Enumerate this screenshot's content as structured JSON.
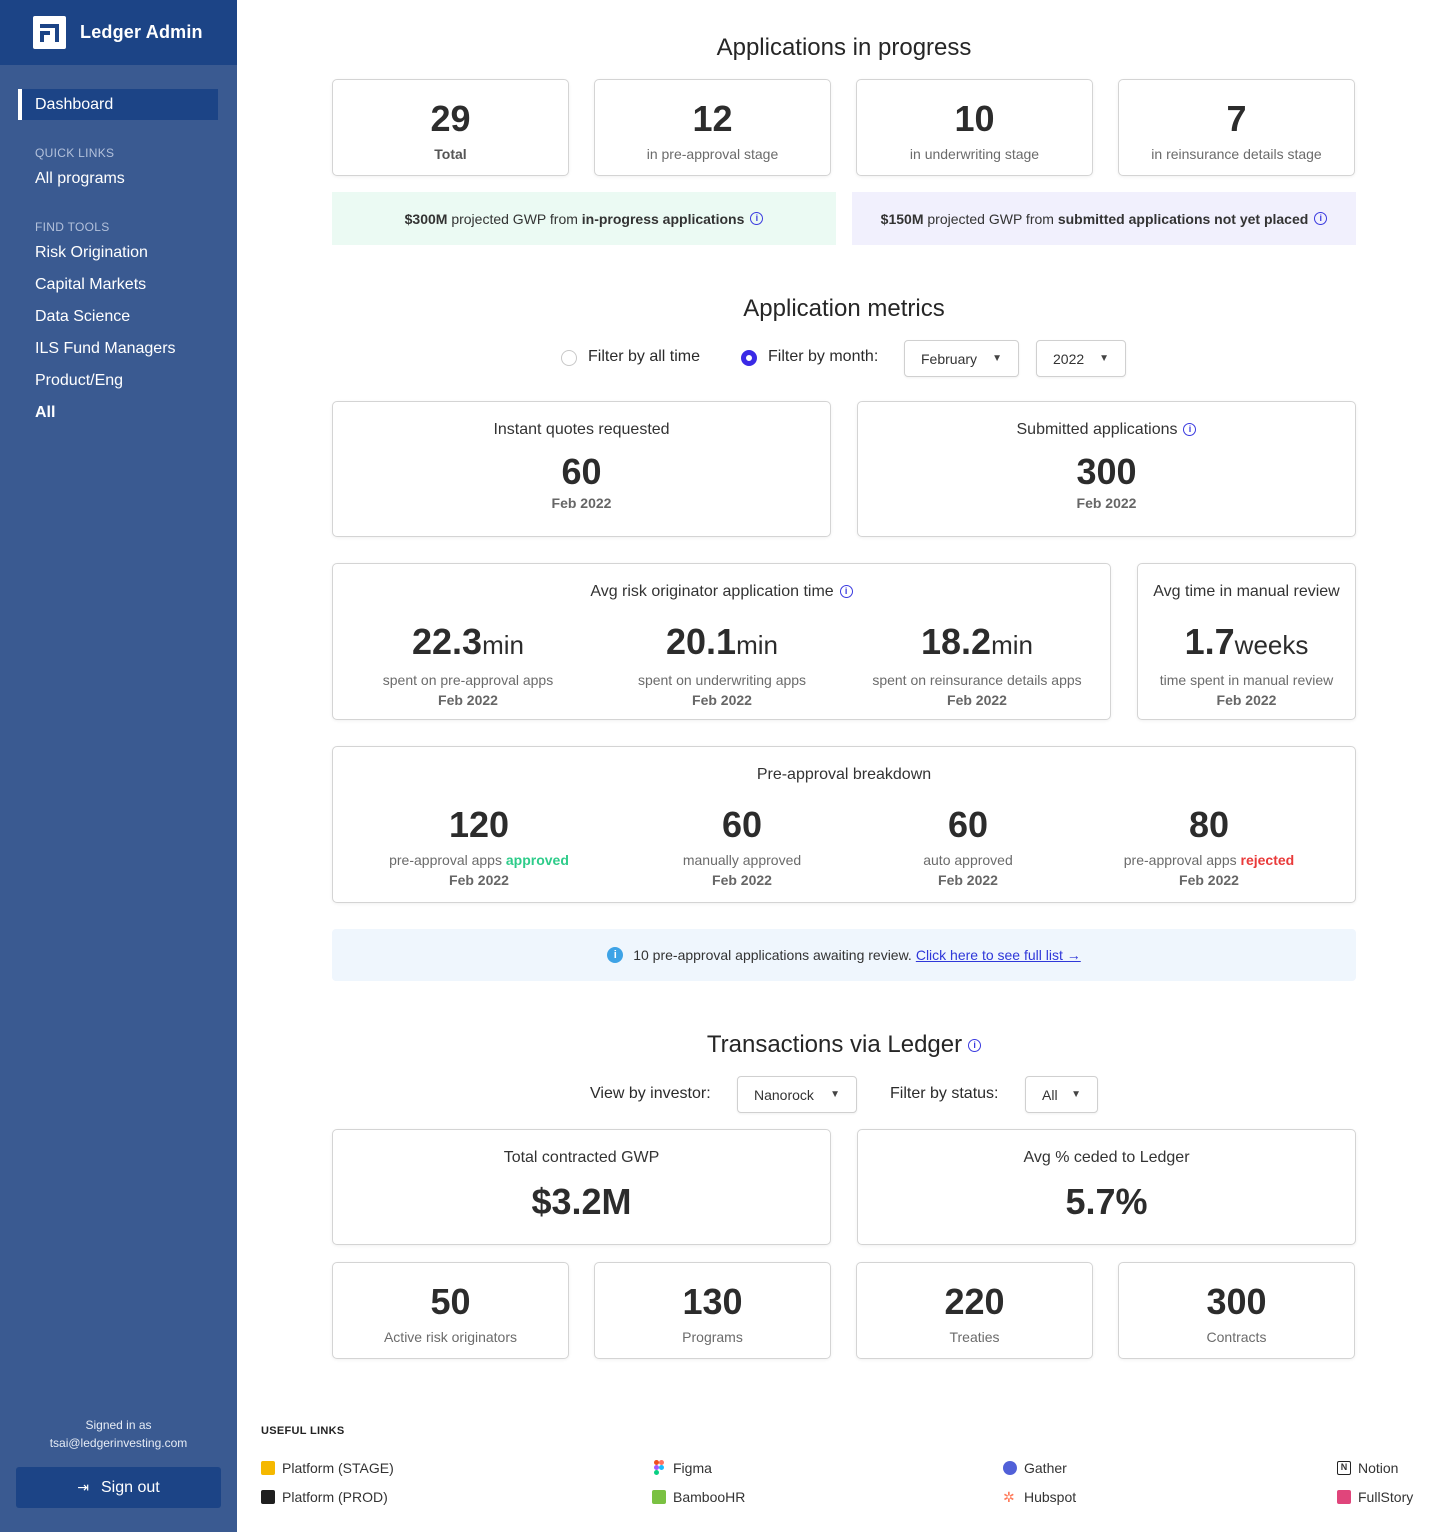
{
  "app": {
    "title": "Ledger Admin"
  },
  "sidebar": {
    "active": "Dashboard",
    "quick_links_label": "QUICK LINKS",
    "quick_links": [
      "All programs"
    ],
    "find_tools_label": "FIND TOOLS",
    "find_tools": [
      "Risk Origination",
      "Capital Markets",
      "Data Science",
      "ILS Fund Managers",
      "Product/Eng",
      "All"
    ],
    "signed_in_label": "Signed in as",
    "signed_in_email": "tsai@ledgerinvesting.com",
    "sign_out": "Sign out"
  },
  "progress": {
    "title": "Applications in progress",
    "stats": [
      {
        "value": "29",
        "label": "Total"
      },
      {
        "value": "12",
        "label": "in pre-approval stage"
      },
      {
        "value": "10",
        "label": "in underwriting stage"
      },
      {
        "value": "7",
        "label": "in reinsurance details stage"
      }
    ],
    "banner_left": {
      "amount": "$300M",
      "text": " projected GWP from ",
      "bold": "in-progress applications"
    },
    "banner_right": {
      "amount": "$150M",
      "text": " projected GWP from ",
      "bold": "submitted applications not yet placed"
    }
  },
  "metrics": {
    "title": "Application metrics",
    "filter_all": "Filter by all time",
    "filter_month": "Filter by month:",
    "month": "February",
    "year": "2022",
    "instant_quotes": {
      "title": "Instant quotes requested",
      "value": "60",
      "date": "Feb 2022"
    },
    "submitted": {
      "title": "Submitted applications",
      "value": "300",
      "date": "Feb 2022"
    },
    "avg_time": {
      "title": "Avg risk originator application time",
      "items": [
        {
          "value": "22.3",
          "unit": "min",
          "desc": "spent on pre-approval apps",
          "date": "Feb 2022"
        },
        {
          "value": "20.1",
          "unit": "min",
          "desc": "spent on underwriting apps",
          "date": "Feb 2022"
        },
        {
          "value": "18.2",
          "unit": "min",
          "desc": "spent on reinsurance details apps",
          "date": "Feb 2022"
        }
      ]
    },
    "manual_review": {
      "title": "Avg time in manual review",
      "value": "1.7",
      "unit": "weeks",
      "desc": "time spent in manual review",
      "date": "Feb 2022"
    },
    "breakdown": {
      "title": "Pre-approval breakdown",
      "items": [
        {
          "value": "120",
          "desc": "pre-approval apps ",
          "highlight": "approved",
          "date": "Feb 2022"
        },
        {
          "value": "60",
          "desc": "manually approved",
          "date": "Feb 2022"
        },
        {
          "value": "60",
          "desc": "auto approved",
          "date": "Feb 2022"
        },
        {
          "value": "80",
          "desc": "pre-approval apps ",
          "highlight": "rejected",
          "date": "Feb 2022"
        }
      ]
    },
    "alert": {
      "text": "10 pre-approval applications awaiting review.",
      "link": "Click here to see full list →"
    }
  },
  "transactions": {
    "title": "Transactions via Ledger",
    "investor_label": "View by investor:",
    "investor": "Nanorock",
    "status_label": "Filter by status:",
    "status": "All",
    "gwp": {
      "title": "Total contracted GWP",
      "value": "$3.2M"
    },
    "ceded": {
      "title": "Avg % ceded to Ledger",
      "value": "5.7%"
    },
    "stats": [
      {
        "value": "50",
        "label": "Active risk originators"
      },
      {
        "value": "130",
        "label": "Programs"
      },
      {
        "value": "220",
        "label": "Treaties"
      },
      {
        "value": "300",
        "label": "Contracts"
      }
    ]
  },
  "useful_links": {
    "title": "USEFUL LINKS",
    "items": [
      "Platform (STAGE)",
      "Platform (PROD)",
      "Figma",
      "BambooHR",
      "Gather",
      "Hubspot",
      "Notion",
      "FullStory"
    ]
  },
  "colors": {
    "sidebar": "#3a5a91",
    "sidebar_dark": "#1c4486",
    "green_banner": "#ebfaf3",
    "purple_banner": "#f1f0fd",
    "accent": "#3a2ae6"
  }
}
